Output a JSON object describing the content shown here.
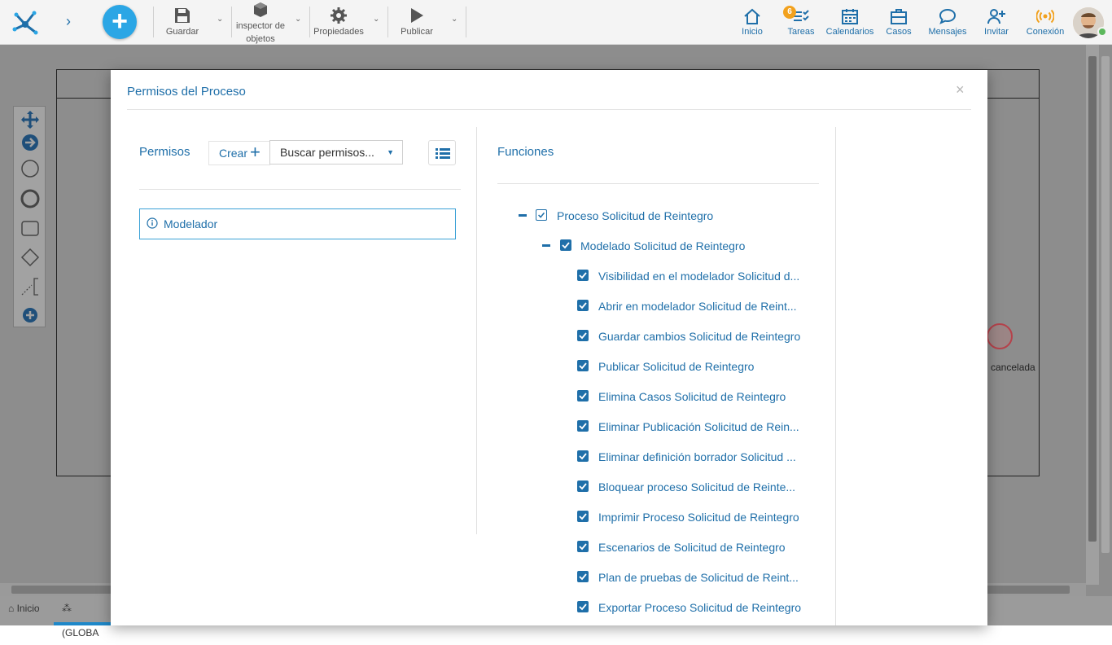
{
  "toolbar": {
    "guardar": "Guardar",
    "inspector_line1": "inspector de",
    "inspector_line2": "objetos",
    "propiedades": "Propiedades",
    "publicar": "Publicar"
  },
  "nav": {
    "inicio": "Inicio",
    "tareas": "Tareas",
    "tareas_badge": "6",
    "calendarios": "Calendarios",
    "casos": "Casos",
    "mensajes": "Mensajes",
    "invitar": "Invitar",
    "conexion": "Conexión"
  },
  "canvas": {
    "event_label": "cancelada"
  },
  "bottom_tabs": {
    "home": "Inicio",
    "global": "(GLOBA"
  },
  "modal": {
    "title": "Permisos del Proceso",
    "close": "×",
    "permisos_label": "Permisos",
    "crear_label": "Crear",
    "search_value": "Buscar permisos...",
    "permission_item": "Modelador",
    "funciones_label": "Funciones",
    "tree": {
      "root": "Proceso Solicitud de Reintegro",
      "child": "Modelado Solicitud de Reintegro",
      "items": [
        "Visibilidad en el modelador Solicitud d...",
        "Abrir en modelador Solicitud de Reint...",
        "Guardar cambios Solicitud de Reintegro",
        "Publicar Solicitud de Reintegro",
        "Elimina Casos Solicitud de Reintegro",
        "Eliminar Publicación Solicitud de Rein...",
        "Eliminar definición borrador Solicitud ...",
        "Bloquear proceso Solicitud de Reinte...",
        "Imprimir Proceso Solicitud de Reintegro",
        "Escenarios de Solicitud de Reintegro",
        "Plan de pruebas de Solicitud de Reint...",
        "Exportar Proceso Solicitud de Reintegro"
      ]
    }
  },
  "colors": {
    "accent": "#1f6fa9",
    "add_button": "#2ba6e5",
    "badge": "#f2a11d",
    "overlay": "#8d8d8d"
  }
}
